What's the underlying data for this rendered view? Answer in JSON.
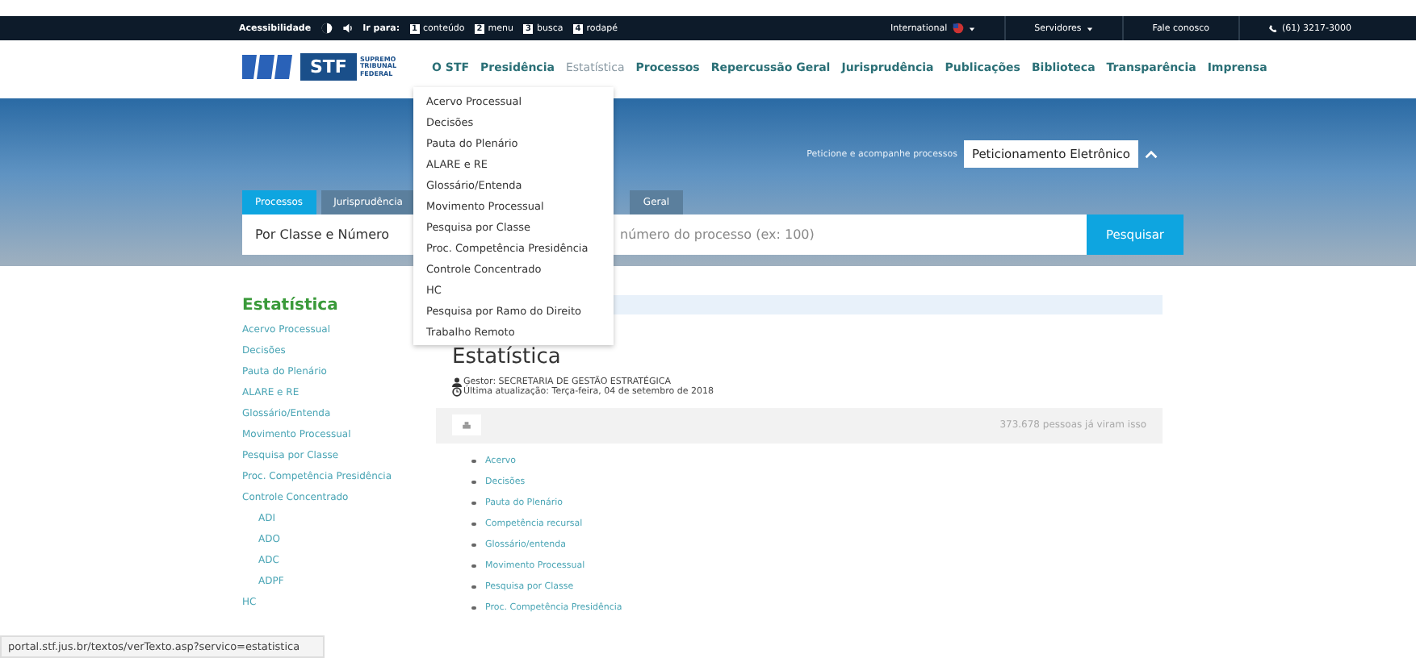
{
  "top_bar": {
    "accessibility": "Acessibilidade",
    "goto": "Ir para:",
    "shortcuts": [
      {
        "key": "1",
        "label": "conteúdo"
      },
      {
        "key": "2",
        "label": "menu"
      },
      {
        "key": "3",
        "label": "busca"
      },
      {
        "key": "4",
        "label": "rodapé"
      }
    ],
    "international": "International",
    "servidores": "Servidores",
    "contact": "Fale conosco",
    "phone": "(61) 3217-3000"
  },
  "header": {
    "logo": {
      "abbr": "STF",
      "lines": [
        "SUPREMO",
        "TRIBUNAL",
        "FEDERAL"
      ]
    },
    "nav": [
      {
        "label": "O STF",
        "selected": false
      },
      {
        "label": "Presidência",
        "selected": false
      },
      {
        "label": "Estatística",
        "selected": true
      },
      {
        "label": "Processos",
        "selected": false
      },
      {
        "label": "Repercussão Geral",
        "selected": false
      },
      {
        "label": "Jurisprudência",
        "selected": false
      },
      {
        "label": "Publicações",
        "selected": false
      },
      {
        "label": "Biblioteca",
        "selected": false
      },
      {
        "label": "Transparência",
        "selected": false
      },
      {
        "label": "Imprensa",
        "selected": false
      }
    ]
  },
  "dropdown": [
    "Acervo Processual",
    "Decisões",
    "Pauta do Plenário",
    "ALARE e RE",
    "Glossário/Entenda",
    "Movimento Processual",
    "Pesquisa por Classe",
    "Proc. Competência Presidência",
    "Controle Concentrado",
    "HC",
    "Pesquisa por Ramo do Direito",
    "Trabalho Remoto"
  ],
  "hero": {
    "petition_hint": "Peticione e acompanhe processos",
    "petition_button": "Peticionamento Eletrônico",
    "tabs": [
      {
        "label": "Processos",
        "selected": true
      },
      {
        "label": "Jurisprudência",
        "selected": false
      },
      {
        "label": "Geral",
        "selected": false
      }
    ],
    "search_type": "Por Classe e Número",
    "search_placeholder": "número do processo (ex: 100)",
    "search_button": "Pesquisar"
  },
  "sidebar": {
    "title": "Estatística",
    "items": [
      {
        "label": "Acervo Processual"
      },
      {
        "label": "Decisões"
      },
      {
        "label": "Pauta do Plenário"
      },
      {
        "label": "ALARE e RE"
      },
      {
        "label": "Glossário/Entenda"
      },
      {
        "label": "Movimento Processual"
      },
      {
        "label": "Pesquisa por Classe"
      },
      {
        "label": "Proc. Competência Presidência"
      },
      {
        "label": "Controle Concentrado",
        "children": [
          {
            "label": "ADI"
          },
          {
            "label": "ADO"
          },
          {
            "label": "ADC"
          },
          {
            "label": "ADPF"
          }
        ]
      },
      {
        "label": "HC"
      }
    ]
  },
  "content": {
    "title": "Estatística",
    "manager": "Gestor: SECRETARIA DE GESTÃO ESTRATÉGICA",
    "updated": "Última atualização: Terça-feira, 04 de setembro de 2018",
    "views": "373.678 pessoas já viram isso",
    "links": [
      "Acervo",
      "Decisões",
      "Pauta do Plenário",
      "Competência recursal",
      "Glossário/entenda",
      "Movimento Processual",
      "Pesquisa por Classe",
      "Proc. Competência Presidência"
    ]
  },
  "status_url": "portal.stf.jus.br/textos/verTexto.asp?servico=estatistica"
}
